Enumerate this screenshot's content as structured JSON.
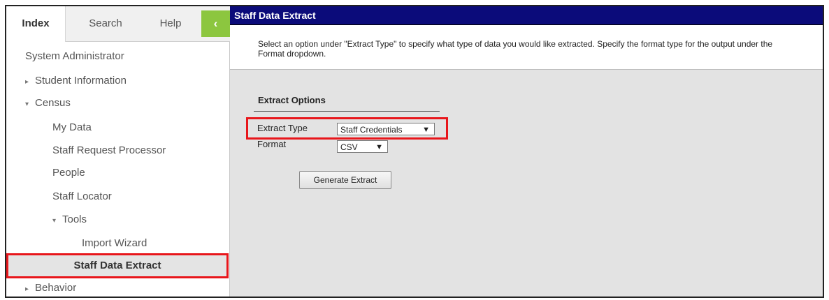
{
  "sidebar": {
    "tabs": [
      "Index",
      "Search",
      "Help"
    ],
    "collapse_glyph": "‹",
    "root": "System Administrator",
    "items": [
      {
        "label": "Student Information",
        "arrow": "▸"
      },
      {
        "label": "Census",
        "arrow": "▾"
      },
      {
        "label": "My Data"
      },
      {
        "label": "Staff Request Processor"
      },
      {
        "label": "People"
      },
      {
        "label": "Staff Locator"
      },
      {
        "label": "Tools",
        "arrow": "▾"
      },
      {
        "label": "Import Wizard"
      },
      {
        "label": "Staff Data Extract"
      },
      {
        "label": "Behavior",
        "arrow": "▸"
      }
    ]
  },
  "main": {
    "title": "Staff Data Extract",
    "instructions": "Select an option under \"Extract Type\" to specify what type of data you would like extracted. Specify the format type for the output under the Format dropdown.",
    "section_title": "Extract Options",
    "extract_type_label": "Extract Type",
    "extract_type_value": "Staff Credentials",
    "format_label": "Format",
    "format_value": "CSV",
    "caret": "▼",
    "generate_button": "Generate Extract"
  },
  "colors": {
    "title_bar": "#0b0b7a",
    "collapse_button": "#8cc63f",
    "highlight": "#e8161b",
    "content_bg": "#e3e3e3"
  },
  "icons": [
    "collapse-chevron-icon",
    "expand-arrow-icon",
    "dropdown-caret-icon"
  ]
}
